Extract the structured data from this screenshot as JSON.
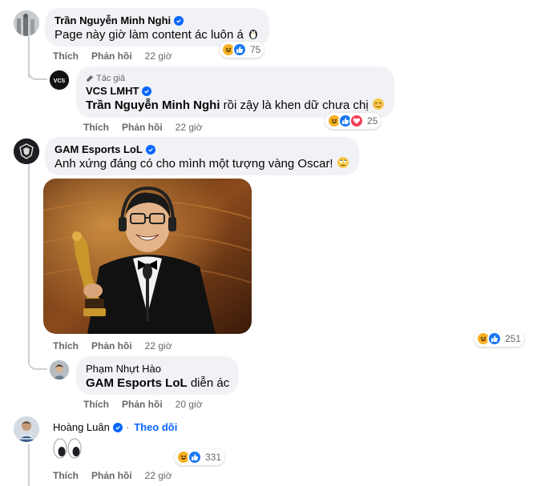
{
  "comments": [
    {
      "author": "Trần Nguyễn Minh Nghi",
      "text": "Page này giờ làm content ác luôn á",
      "like_label": "Thích",
      "reply_label": "Phản hồi",
      "time": "22 giờ",
      "reaction_count": "75",
      "reply": {
        "author_badge": "Tác giả",
        "author": "VCS LMHT",
        "mention": "Trần Nguyễn Minh Nghi",
        "text": " rồi zậy là khen dữ chưa chị",
        "like_label": "Thích",
        "reply_label": "Phản hồi",
        "time": "22 giờ",
        "reaction_count": "25"
      }
    },
    {
      "author": "GAM Esports LoL",
      "text": "Anh xứng đáng có cho mình một tượng vàng Oscar!",
      "like_label": "Thích",
      "reply_label": "Phản hồi",
      "time": "22 giờ",
      "reaction_count": "251",
      "reply": {
        "author": "Phạm Nhựt Hào",
        "mention": "GAM Esports LoL",
        "text": " diễn ác",
        "like_label": "Thích",
        "reply_label": "Phản hồi",
        "time": "20 giờ"
      }
    },
    {
      "author": "Hoàng Luân",
      "follow_label": "Theo dõi",
      "text": "👀",
      "like_label": "Thích",
      "reply_label": "Phản hồi",
      "time": "22 giờ",
      "reaction_count": "331"
    }
  ],
  "colors": {
    "bubble": "#f0f2f5",
    "meta_text": "#65676b",
    "verified": "#0866ff",
    "like": "#1877f2",
    "haha": "#f7b125",
    "love": "#f33e58"
  }
}
